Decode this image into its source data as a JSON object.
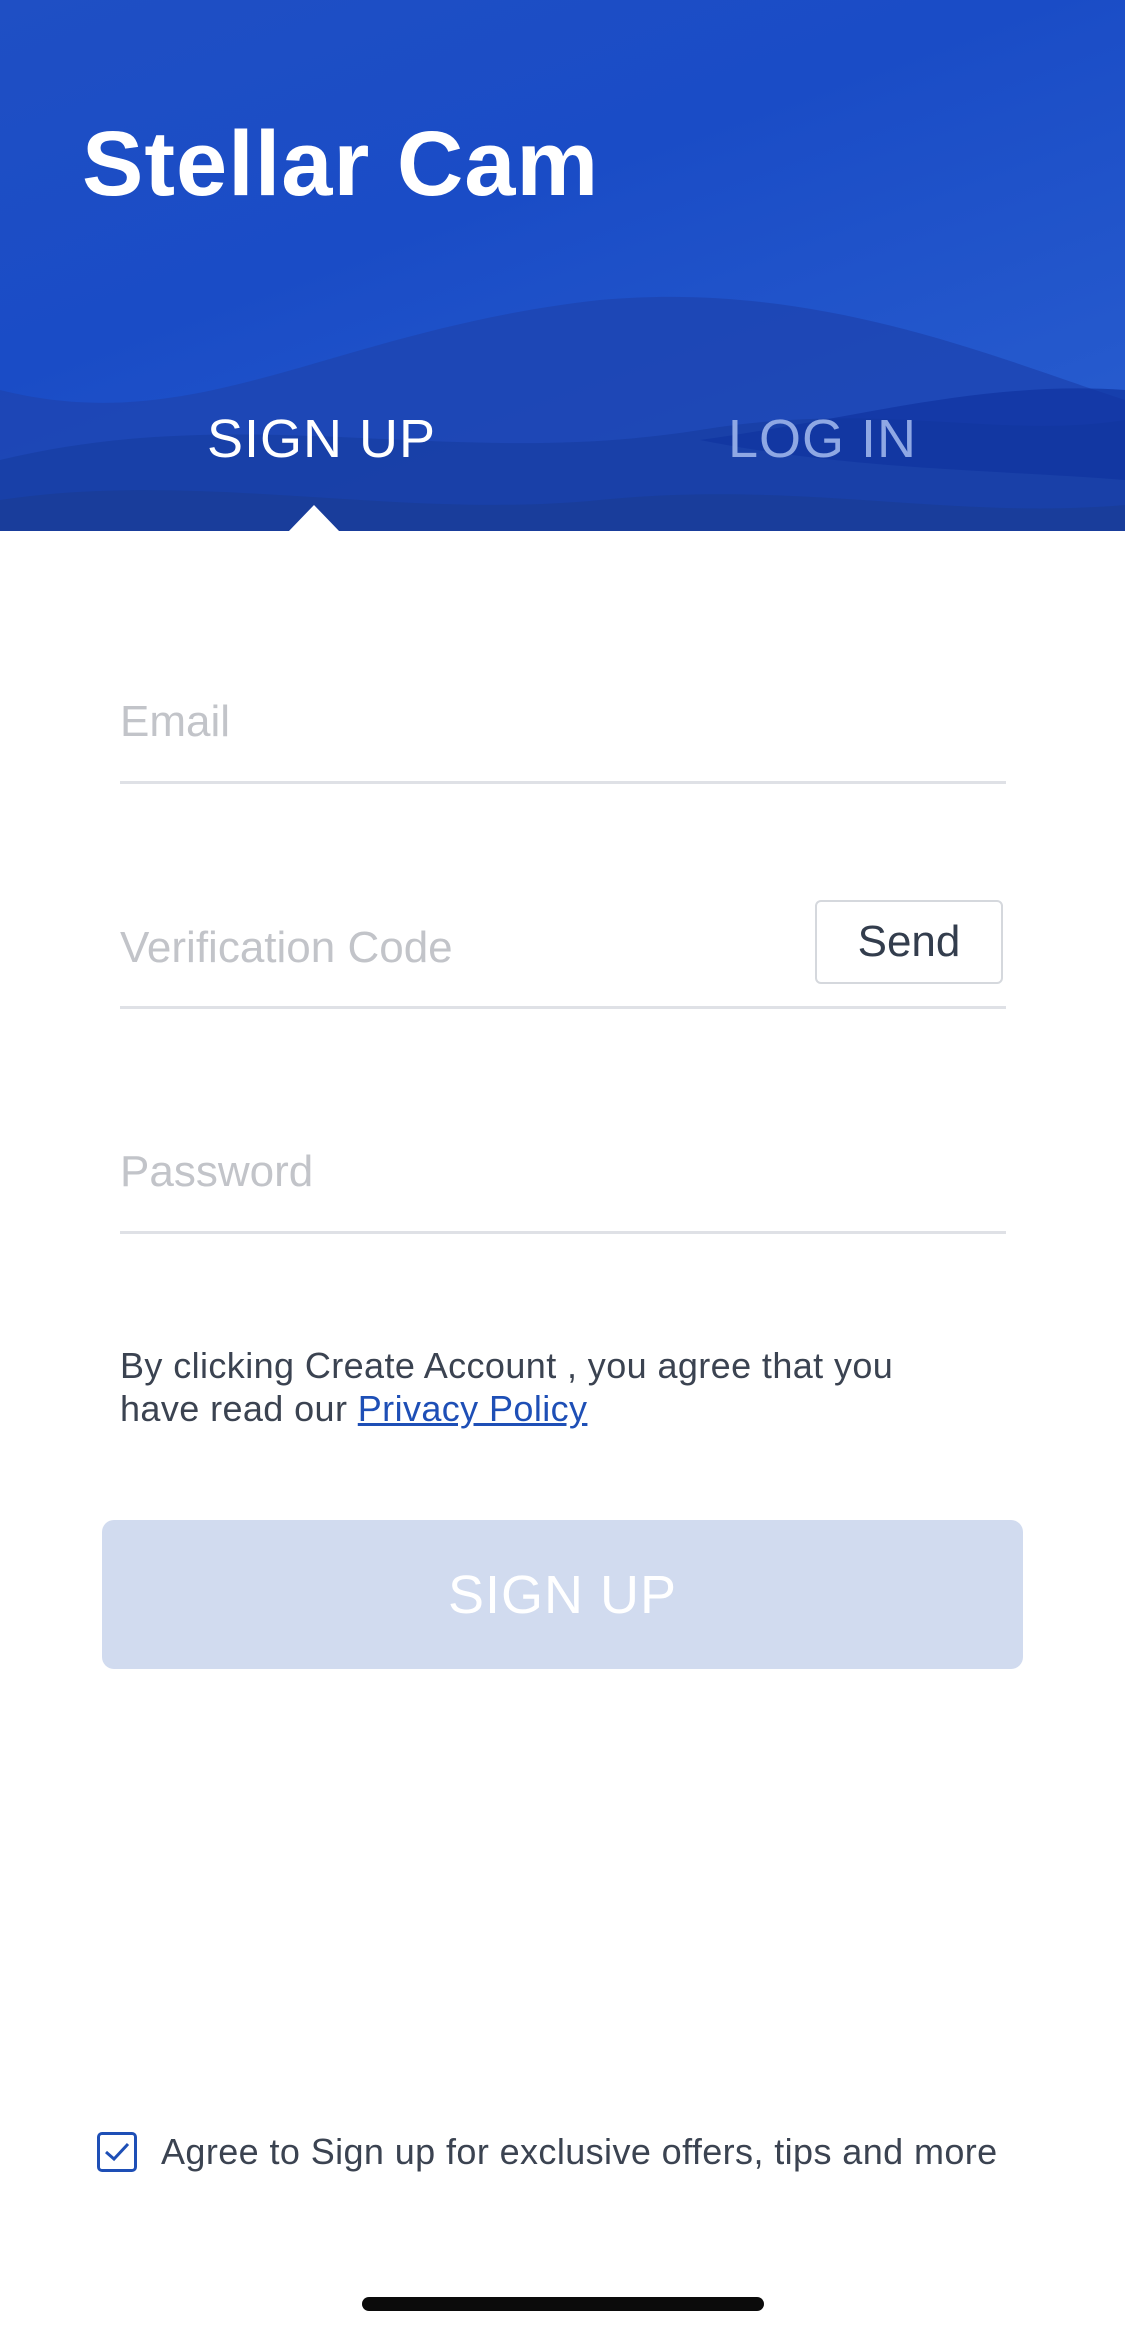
{
  "header": {
    "app_title": "Stellar Cam",
    "tabs": [
      {
        "label": "SIGN UP",
        "active": true
      },
      {
        "label": "LOG IN",
        "active": false
      }
    ],
    "gradient_colors": [
      "#1f4fc4",
      "#2a5fd0"
    ]
  },
  "form": {
    "email_placeholder": "Email",
    "verification_placeholder": "Verification Code",
    "send_label": "Send",
    "password_placeholder": "Password",
    "policy_text_prefix": "By clicking Create Account , you agree that you have read our ",
    "policy_link": "Privacy Policy",
    "signup_button_label": "SIGN UP"
  },
  "agree": {
    "checked": true,
    "label": "Agree to Sign up for exclusive offers, tips and more"
  },
  "colors": {
    "accent": "#1e4fb6",
    "button_disabled": "#d1dbef",
    "text": "#3b4351"
  }
}
